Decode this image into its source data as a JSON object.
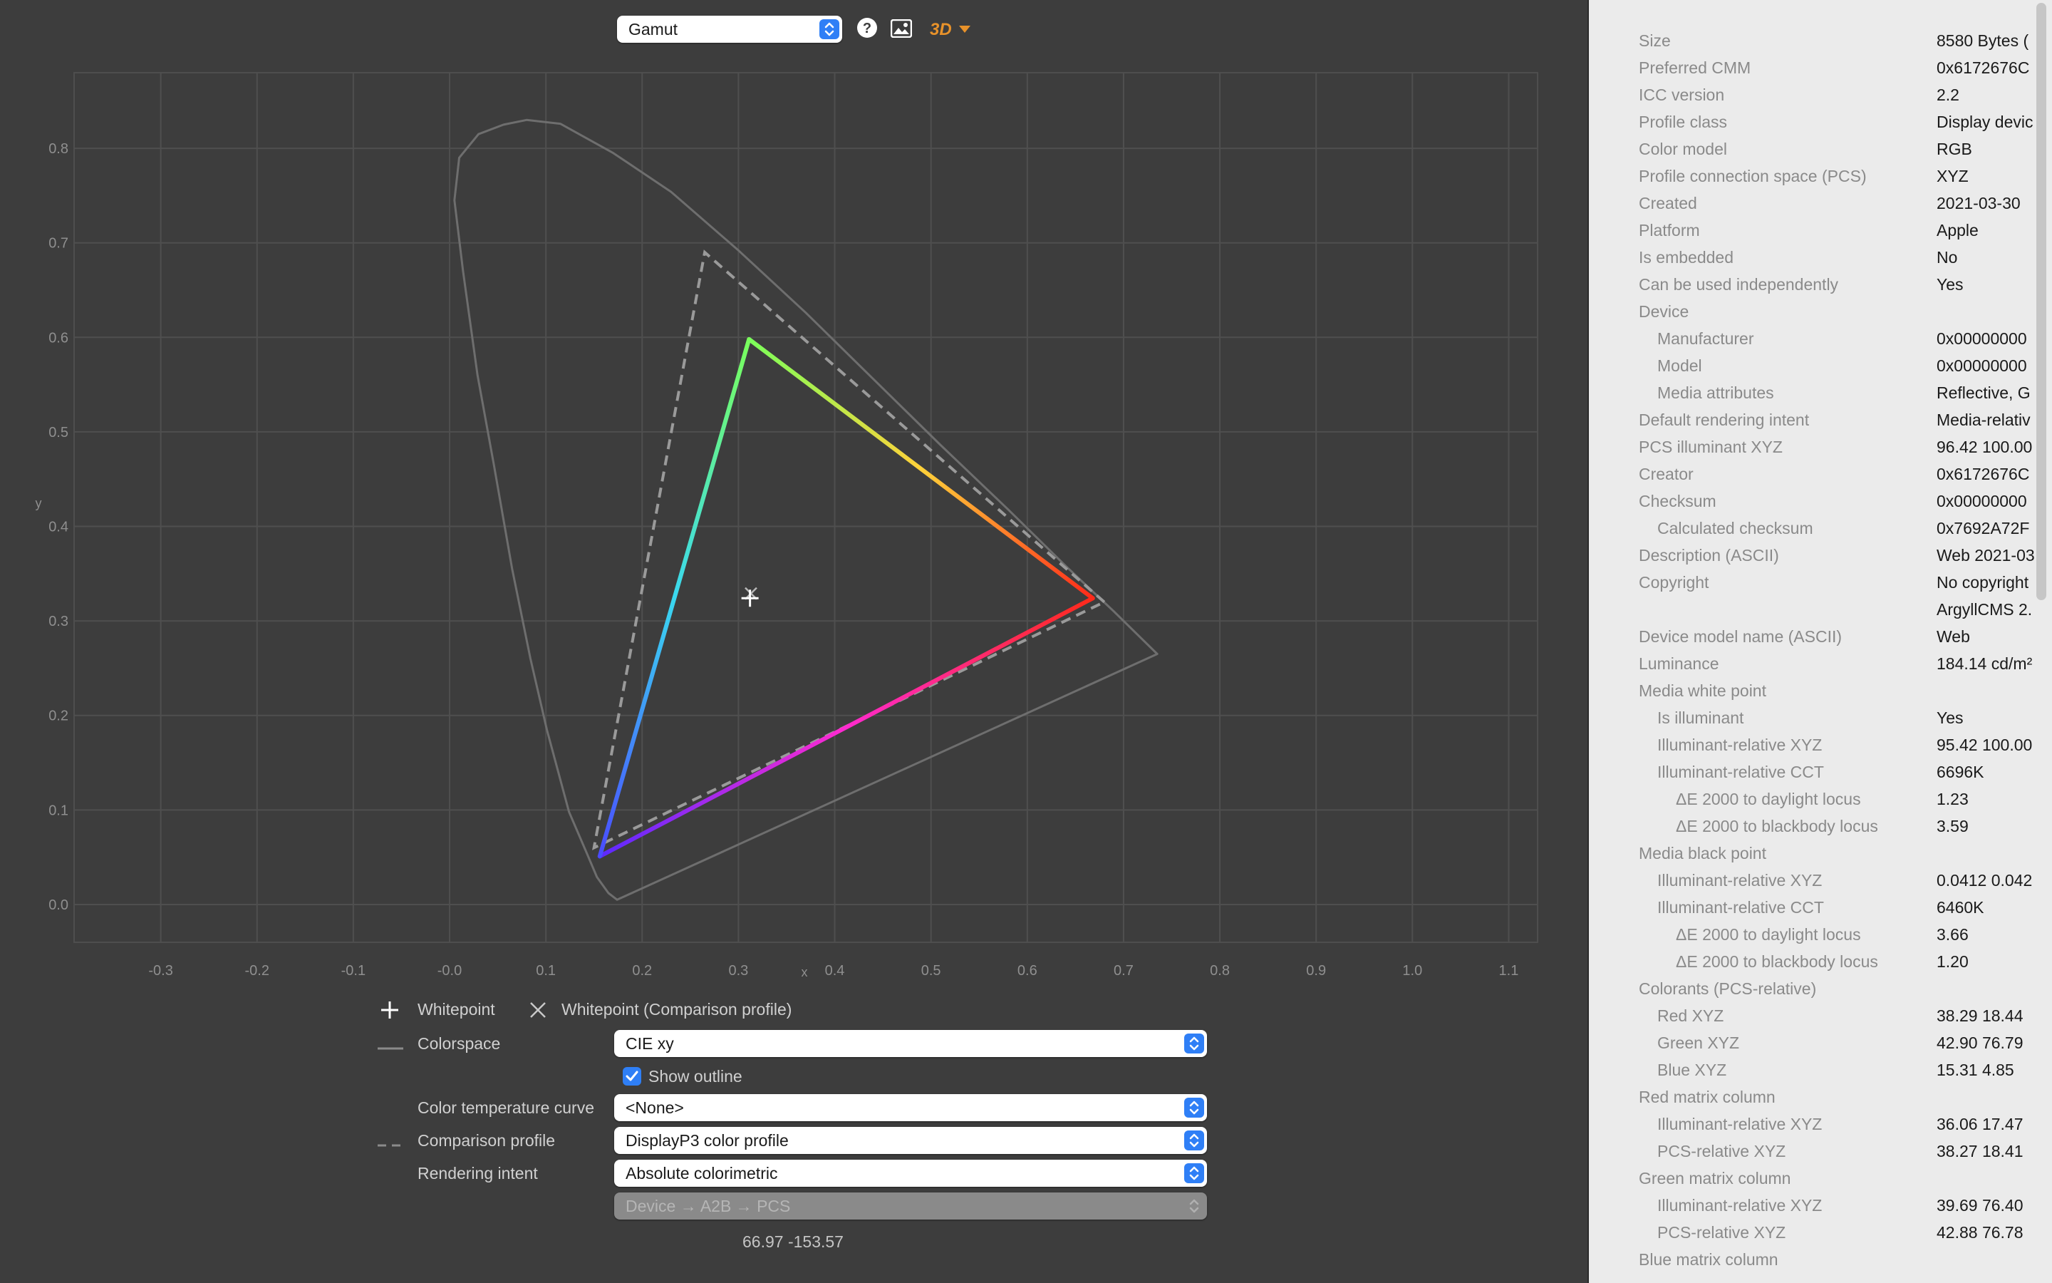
{
  "toolbar": {
    "view_select": "Gamut",
    "icons": [
      "help-icon",
      "image-icon",
      "3d-view-icon"
    ],
    "view_3d_label": "3D"
  },
  "chart_data": {
    "type": "scatter",
    "xlabel": "x",
    "ylabel": "y",
    "xlim": [
      -0.39,
      1.13
    ],
    "ylim": [
      -0.04,
      0.88
    ],
    "x_ticks": [
      "-0.3",
      "-0.2",
      "-0.1",
      "-0.0",
      "0.1",
      "0.2",
      "0.3",
      "0.4",
      "0.5",
      "0.6",
      "0.7",
      "0.8",
      "0.9",
      "1.0",
      "1.1"
    ],
    "x_tick_values": [
      -0.3,
      -0.2,
      -0.1,
      0,
      0.1,
      0.2,
      0.3,
      0.4,
      0.5,
      0.6,
      0.7,
      0.8,
      0.9,
      1.0,
      1.1
    ],
    "y_ticks": [
      "0.0",
      "0.1",
      "0.2",
      "0.3",
      "0.4",
      "0.5",
      "0.6",
      "0.7",
      "0.8"
    ],
    "y_tick_values": [
      0,
      0.1,
      0.2,
      0.3,
      0.4,
      0.5,
      0.6,
      0.7,
      0.8
    ],
    "grid": true,
    "spectral_locus": [
      [
        0.174,
        0.005
      ],
      [
        0.165,
        0.012
      ],
      [
        0.153,
        0.029
      ],
      [
        0.143,
        0.053
      ],
      [
        0.124,
        0.098
      ],
      [
        0.101,
        0.185
      ],
      [
        0.084,
        0.26
      ],
      [
        0.065,
        0.355
      ],
      [
        0.046,
        0.465
      ],
      [
        0.029,
        0.56
      ],
      [
        0.014,
        0.67
      ],
      [
        0.005,
        0.745
      ],
      [
        0.01,
        0.79
      ],
      [
        0.03,
        0.815
      ],
      [
        0.056,
        0.825
      ],
      [
        0.08,
        0.83
      ],
      [
        0.115,
        0.826
      ],
      [
        0.17,
        0.795
      ],
      [
        0.23,
        0.754
      ],
      [
        0.3,
        0.692
      ],
      [
        0.37,
        0.626
      ],
      [
        0.44,
        0.556
      ],
      [
        0.51,
        0.486
      ],
      [
        0.58,
        0.418
      ],
      [
        0.64,
        0.358
      ],
      [
        0.69,
        0.31
      ],
      [
        0.735,
        0.265
      ]
    ],
    "profile_gamut": {
      "red": [
        0.668,
        0.324
      ],
      "green": [
        0.311,
        0.598
      ],
      "blue": [
        0.156,
        0.051
      ]
    },
    "comparison_gamut": {
      "red": [
        0.68,
        0.32
      ],
      "green": [
        0.265,
        0.69
      ],
      "blue": [
        0.15,
        0.06
      ]
    },
    "whitepoint": [
      0.312,
      0.324
    ],
    "comparison_whitepoint": [
      0.313,
      0.329
    ]
  },
  "legend": {
    "whitepoint": "Whitepoint",
    "whitepoint_comparison": "Whitepoint (Comparison profile)"
  },
  "controls": {
    "colorspace_label": "Colorspace",
    "colorspace_value": "CIE xy",
    "show_outline_label": "Show outline",
    "show_outline_checked": true,
    "color_temp_label": "Color temperature curve",
    "color_temp_value": "<None>",
    "comparison_label": "Comparison profile",
    "comparison_value": "DisplayP3 color profile",
    "rendering_label": "Rendering intent",
    "rendering_value": "Absolute colorimetric",
    "transform_value": "Device → A2B → PCS",
    "readout": "66.97 -153.57"
  },
  "properties": [
    {
      "key": "Size",
      "value": "8580 Bytes (",
      "indent": 0
    },
    {
      "key": "Preferred CMM",
      "value": "0x6172676C",
      "indent": 0
    },
    {
      "key": "ICC version",
      "value": "2.2",
      "indent": 0
    },
    {
      "key": "Profile class",
      "value": "Display devic",
      "indent": 0
    },
    {
      "key": "Color model",
      "value": "RGB",
      "indent": 0
    },
    {
      "key": "Profile connection space (PCS)",
      "value": "XYZ",
      "indent": 0
    },
    {
      "key": "Created",
      "value": "2021-03-30",
      "indent": 0
    },
    {
      "key": "Platform",
      "value": "Apple",
      "indent": 0
    },
    {
      "key": "Is embedded",
      "value": "No",
      "indent": 0
    },
    {
      "key": "Can be used independently",
      "value": "Yes",
      "indent": 0
    },
    {
      "key": "Device",
      "value": "",
      "indent": 0
    },
    {
      "key": "Manufacturer",
      "value": "0x00000000",
      "indent": 1
    },
    {
      "key": "Model",
      "value": "0x00000000",
      "indent": 1
    },
    {
      "key": "Media attributes",
      "value": "Reflective, G",
      "indent": 1
    },
    {
      "key": "Default rendering intent",
      "value": "Media-relativ",
      "indent": 0
    },
    {
      "key": "PCS illuminant XYZ",
      "value": "96.42 100.00",
      "indent": 0
    },
    {
      "key": "Creator",
      "value": "0x6172676C",
      "indent": 0
    },
    {
      "key": "Checksum",
      "value": "0x00000000",
      "indent": 0
    },
    {
      "key": "Calculated checksum",
      "value": "0x7692A72F",
      "indent": 1
    },
    {
      "key": "Description (ASCII)",
      "value": "Web 2021-03",
      "indent": 0
    },
    {
      "key": "Copyright",
      "value": "No copyright",
      "indent": 0
    },
    {
      "key": "",
      "value": "ArgyllCMS 2.",
      "indent": 0
    },
    {
      "key": "Device model name (ASCII)",
      "value": "Web",
      "indent": 0
    },
    {
      "key": "Luminance",
      "value": "184.14 cd/m²",
      "indent": 0
    },
    {
      "key": "Media white point",
      "value": "",
      "indent": 0
    },
    {
      "key": "Is illuminant",
      "value": "Yes",
      "indent": 1
    },
    {
      "key": "Illuminant-relative XYZ",
      "value": "95.42 100.00",
      "indent": 1
    },
    {
      "key": "Illuminant-relative CCT",
      "value": "6696K",
      "indent": 1
    },
    {
      "key": "ΔE 2000 to daylight locus",
      "value": "1.23",
      "indent": 2
    },
    {
      "key": "ΔE 2000 to blackbody locus",
      "value": "3.59",
      "indent": 2
    },
    {
      "key": "Media black point",
      "value": "",
      "indent": 0
    },
    {
      "key": "Illuminant-relative XYZ",
      "value": "0.0412 0.042",
      "indent": 1
    },
    {
      "key": "Illuminant-relative CCT",
      "value": "6460K",
      "indent": 1
    },
    {
      "key": "ΔE 2000 to daylight locus",
      "value": "3.66",
      "indent": 2
    },
    {
      "key": "ΔE 2000 to blackbody locus",
      "value": "1.20",
      "indent": 2
    },
    {
      "key": "Colorants (PCS-relative)",
      "value": "",
      "indent": 0
    },
    {
      "key": "Red XYZ",
      "value": "38.29  18.44",
      "indent": 1
    },
    {
      "key": "Green XYZ",
      "value": "42.90  76.79",
      "indent": 1
    },
    {
      "key": "Blue XYZ",
      "value": "15.31   4.85",
      "indent": 1
    },
    {
      "key": "Red matrix column",
      "value": "",
      "indent": 0
    },
    {
      "key": "Illuminant-relative XYZ",
      "value": "36.06  17.47",
      "indent": 1
    },
    {
      "key": "PCS-relative XYZ",
      "value": "38.27  18.41",
      "indent": 1
    },
    {
      "key": "Green matrix column",
      "value": "",
      "indent": 0
    },
    {
      "key": "Illuminant-relative XYZ",
      "value": "39.69  76.40",
      "indent": 1
    },
    {
      "key": "PCS-relative XYZ",
      "value": "42.88  76.78",
      "indent": 1
    },
    {
      "key": "Blue matrix column",
      "value": "",
      "indent": 0
    }
  ]
}
